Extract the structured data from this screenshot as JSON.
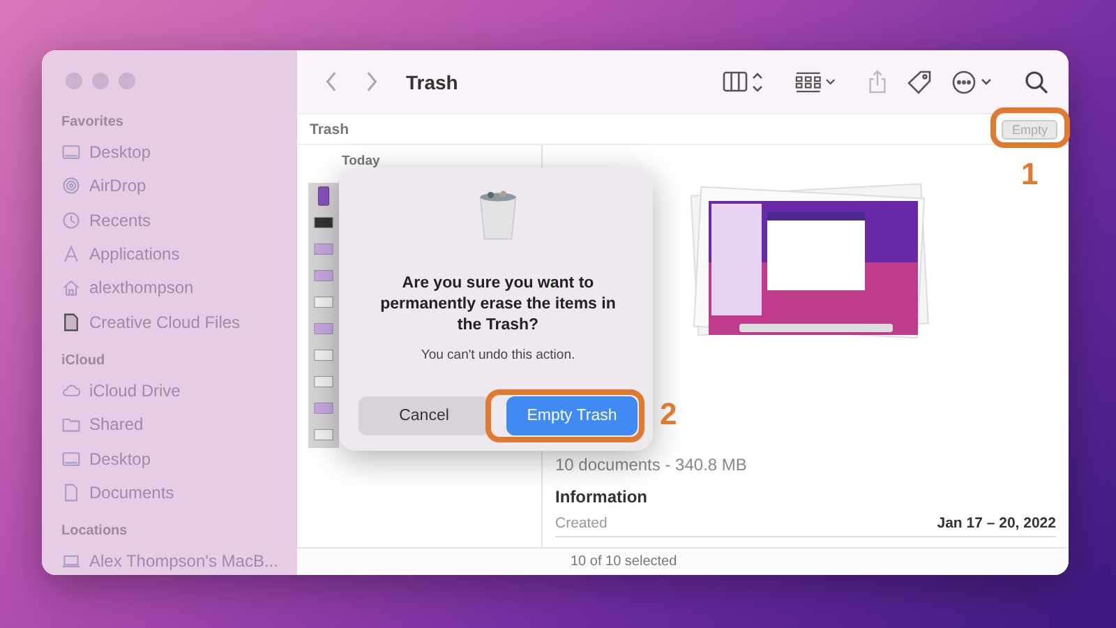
{
  "window": {
    "title": "Trash"
  },
  "sidebar": {
    "sections": [
      {
        "title": "Favorites",
        "items": [
          {
            "label": "Desktop",
            "kind": "desktop"
          },
          {
            "label": "AirDrop",
            "kind": "airdrop"
          },
          {
            "label": "Recents",
            "kind": "clock"
          },
          {
            "label": "Applications",
            "kind": "apps"
          },
          {
            "label": "alexthompson",
            "kind": "home"
          },
          {
            "label": "Creative Cloud Files",
            "kind": "file"
          }
        ]
      },
      {
        "title": "iCloud",
        "items": [
          {
            "label": "iCloud Drive",
            "kind": "cloud"
          },
          {
            "label": "Shared",
            "kind": "folder"
          },
          {
            "label": "Desktop",
            "kind": "desktop"
          },
          {
            "label": "Documents",
            "kind": "doc"
          }
        ]
      },
      {
        "title": "Locations",
        "items": [
          {
            "label": "Alex Thompson's MacB...",
            "kind": "laptop"
          }
        ]
      }
    ]
  },
  "path_bar": {
    "label": "Trash",
    "button": {
      "label": "Empty",
      "disabled": true
    }
  },
  "list": {
    "header": "Today",
    "files": [
      {
        "kind": "portrait"
      },
      {
        "kind": "dark"
      },
      {
        "kind": "screenshot"
      },
      {
        "kind": "screenshot"
      },
      {
        "kind": "blank"
      },
      {
        "kind": "screenshot"
      },
      {
        "kind": "blank"
      },
      {
        "kind": "blank"
      },
      {
        "kind": "screenshot"
      },
      {
        "kind": "blank"
      }
    ]
  },
  "preview": {
    "summary": "10 documents - 340.8 MB",
    "section": "Information",
    "rows": [
      {
        "label": "Created",
        "value": "Jan 17 – 20, 2022"
      }
    ]
  },
  "status_bar": "10 of 10 selected",
  "dialog": {
    "message": "Are you sure you want to permanently erase the items in the Trash?",
    "detail": "You can't undo this action.",
    "buttons": [
      {
        "label": "Cancel",
        "kind": "secondary"
      },
      {
        "label": "Empty Trash",
        "kind": "primary"
      }
    ]
  },
  "annotations": [
    {
      "label": "1",
      "kind": "toolbar"
    },
    {
      "label": "2",
      "kind": "dialog"
    }
  ]
}
